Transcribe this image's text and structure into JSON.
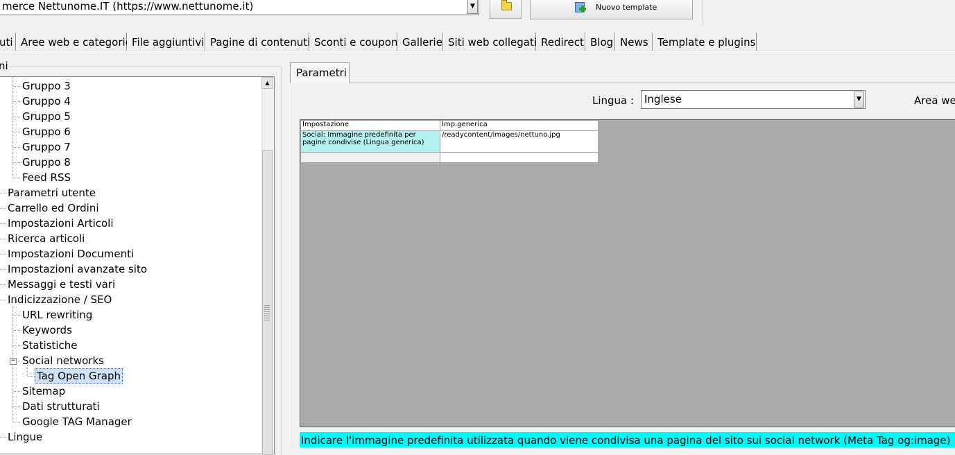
{
  "toolbar": {
    "site_selector": "merce Nettunome.IT (https://www.nettunome.it)",
    "new_template_label": "Nuovo template"
  },
  "main_tabs": [
    "uti",
    "Aree web e categorie",
    "File aggiuntivi",
    "Pagine di contenuti",
    "Sconti e coupon",
    "Gallerie",
    "Siti web collegati",
    "Redirect",
    "Blog",
    "News",
    "Template e plugins"
  ],
  "left_group_title": "ni",
  "tree": {
    "items": [
      {
        "label": "Gruppo 3"
      },
      {
        "label": "Gruppo 4"
      },
      {
        "label": "Gruppo 5"
      },
      {
        "label": "Gruppo 6"
      },
      {
        "label": "Gruppo 7"
      },
      {
        "label": "Gruppo 8"
      },
      {
        "label": "Feed RSS"
      },
      {
        "label": "Parametri utente"
      },
      {
        "label": "Carrello ed Ordini"
      },
      {
        "label": "Impostazioni Articoli"
      },
      {
        "label": "Ricerca articoli"
      },
      {
        "label": "Impostazioni Documenti"
      },
      {
        "label": "Impostazioni avanzate sito"
      },
      {
        "label": "Messaggi e testi vari"
      },
      {
        "label": "Indicizzazione / SEO"
      },
      {
        "label": "URL rewriting"
      },
      {
        "label": "Keywords"
      },
      {
        "label": "Statistiche"
      },
      {
        "label": "Social networks"
      },
      {
        "label": "Tag Open Graph"
      },
      {
        "label": "Sitemap"
      },
      {
        "label": "Dati strutturati"
      },
      {
        "label": "Google TAG Manager"
      },
      {
        "label": "Lingue"
      }
    ]
  },
  "right_panel": {
    "tab_label": "Parametri",
    "language_label": "Lingua :",
    "language_value": "Inglese",
    "area_label": "Area we"
  },
  "grid": {
    "columns": [
      "Impostazione",
      "Imp.generica"
    ],
    "rows": [
      {
        "setting": "Social: Immagine predefinita per pagine condivise (Lingua generica)",
        "value": "/readycontent/images/nettuno.jpg"
      },
      {
        "setting": "",
        "value": ""
      }
    ]
  },
  "hint": "Indicare l'immagine predefinita utilizzata quando viene condivisa una pagina del sito sui social network (Meta Tag og:image)"
}
